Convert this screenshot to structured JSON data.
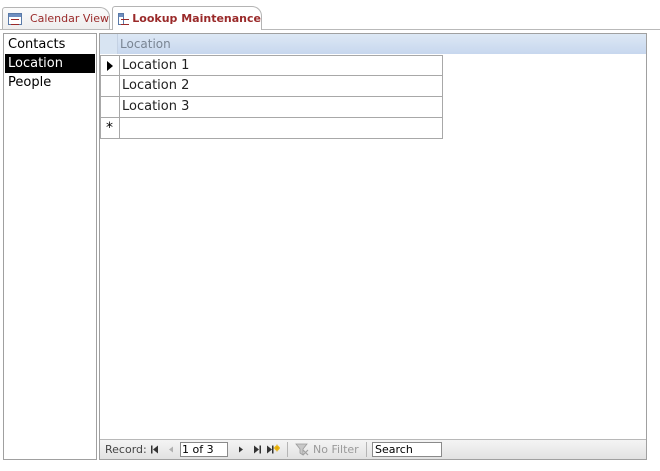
{
  "tabs": [
    {
      "label": "Calendar View",
      "icon": "form-icon",
      "active": false
    },
    {
      "label": "Lookup Maintenance",
      "icon": "form-icon",
      "active": true
    }
  ],
  "lookup_list": {
    "items": [
      {
        "label": "Contacts",
        "selected": false
      },
      {
        "label": "Location",
        "selected": true
      },
      {
        "label": "People",
        "selected": false
      }
    ]
  },
  "datasheet": {
    "column_header": "Location",
    "rows": [
      "Location 1",
      "Location 2",
      "Location 3"
    ],
    "new_row_marker": "*"
  },
  "navigation": {
    "record_label": "Record:",
    "record_position": "1 of 3",
    "filter_label": "No Filter",
    "search_value": "Search"
  },
  "colors": {
    "tab_text": "#9a2a2a",
    "header_bg": "#c7d7ee",
    "selection_bg": "#000000"
  }
}
